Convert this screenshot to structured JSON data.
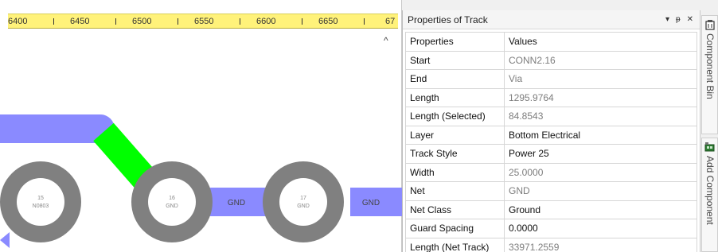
{
  "ruler": {
    "labels": [
      "6400",
      "6450",
      "6500",
      "6550",
      "6600",
      "6650",
      "67"
    ]
  },
  "pcb": {
    "pads": [
      {
        "number": "15",
        "net": "N0803"
      },
      {
        "number": "16",
        "net": "GND"
      },
      {
        "number": "17",
        "net": "GND"
      }
    ],
    "track_labels": [
      "GND",
      "GND"
    ],
    "colors": {
      "track": "#8a8aff",
      "selected_track": "#00ff00",
      "pad": "#808080"
    }
  },
  "properties": {
    "title": "Properties of Track",
    "controls": {
      "dropdown": "▾",
      "pin": "ᵽ",
      "close": "✕"
    },
    "columns": [
      "Properties",
      "Values"
    ],
    "rows": [
      {
        "key": "Start",
        "value": "CONN2.16",
        "editable": false
      },
      {
        "key": "End",
        "value": "Via",
        "editable": false
      },
      {
        "key": "Length",
        "value": "1295.9764",
        "editable": false
      },
      {
        "key": "Length (Selected)",
        "value": "84.8543",
        "editable": false
      },
      {
        "key": "Layer",
        "value": "Bottom Electrical",
        "editable": true
      },
      {
        "key": "Track Style",
        "value": "Power 25",
        "editable": true
      },
      {
        "key": "Width",
        "value": "25.0000",
        "editable": false
      },
      {
        "key": "Net",
        "value": "GND",
        "editable": false
      },
      {
        "key": "Net Class",
        "value": "Ground",
        "editable": true
      },
      {
        "key": "Guard Spacing",
        "value": "0.0000",
        "editable": true
      },
      {
        "key": "Length (Net Track)",
        "value": "33971.2559",
        "editable": false
      }
    ]
  },
  "side_tabs": [
    {
      "label": "Component Bin",
      "icon": "component-bin-icon"
    },
    {
      "label": "Add Component",
      "icon": "add-component-icon"
    }
  ]
}
